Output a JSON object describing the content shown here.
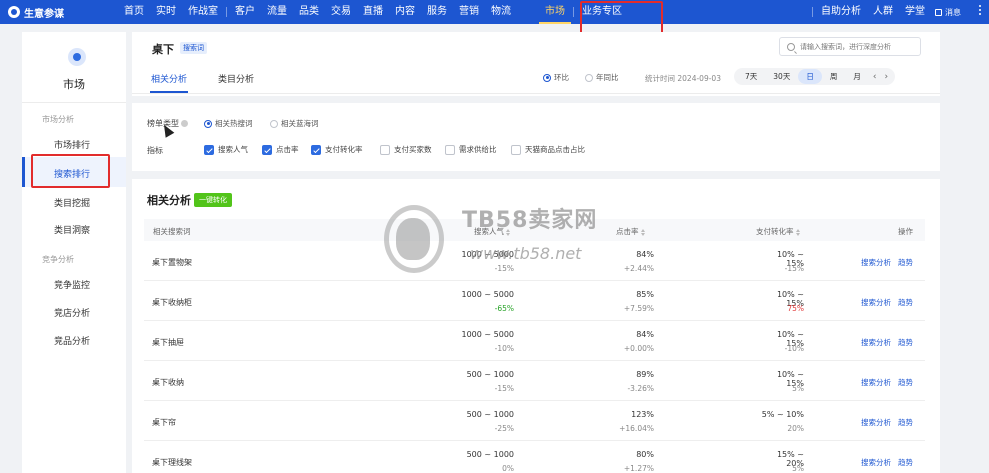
{
  "app": {
    "logo_text": "生意参谋"
  },
  "topnav": {
    "items": [
      "首页",
      "实时",
      "作战室",
      "客户",
      "流量",
      "品类",
      "交易",
      "直播",
      "内容",
      "服务",
      "营销",
      "物流",
      "市场",
      "业务专区"
    ],
    "right_items": [
      "自助分析",
      "人群",
      "学堂"
    ],
    "active": "市场",
    "message": "消息"
  },
  "sidebar": {
    "title": "市场",
    "group1": "市场分析",
    "items1": [
      "市场排行",
      "搜索排行",
      "类目挖掘",
      "类目洞察"
    ],
    "group2": "竞争分析",
    "items2": [
      "竞争监控",
      "竞店分析",
      "竞品分析"
    ],
    "active": "搜索排行"
  },
  "header": {
    "keyword": "桌下",
    "tag": "搜索词",
    "search_placeholder": "请输入搜索词，进行深度分析"
  },
  "tabs": [
    "相关分析",
    "类目分析"
  ],
  "compare": {
    "options": [
      "环比",
      "年同比"
    ],
    "selected": "环比"
  },
  "stat_time": "统计时间 2024-09-03",
  "periods": [
    "7天",
    "30天",
    "日",
    "周",
    "月"
  ],
  "active_period": "日",
  "filters": {
    "rank_type_label": "榜单类型",
    "rank_types": [
      "相关热搜词",
      "相关蓝海词"
    ],
    "rank_selected": "相关热搜词",
    "metrics_label": "指标",
    "metrics": [
      {
        "label": "搜索人气",
        "checked": true
      },
      {
        "label": "点击率",
        "checked": true
      },
      {
        "label": "支付转化率",
        "checked": true
      },
      {
        "label": "支付买家数",
        "checked": false
      },
      {
        "label": "需求供给比",
        "checked": false
      },
      {
        "label": "天猫商品点击占比",
        "checked": false
      }
    ]
  },
  "table": {
    "title": "相关分析",
    "convert_button": "一键转化",
    "headers": [
      "相关搜索词",
      "搜索人气",
      "点击率",
      "支付转化率",
      "操作"
    ],
    "action_labels": [
      "搜索分析",
      "趋势"
    ],
    "rows": [
      {
        "keyword": "桌下置物架",
        "popularity": "1000 ~ 5000",
        "pop_change": "-15%",
        "ctr": "84%",
        "ctr_change": "+2.44%",
        "cvr": "10% ~ 15%",
        "cvr_change": "-15%"
      },
      {
        "keyword": "桌下收纳柜",
        "popularity": "1000 ~ 5000",
        "pop_change": "-65%",
        "ctr": "85%",
        "ctr_change": "+7.59%",
        "cvr": "10% ~ 15%",
        "cvr_change": "75%"
      },
      {
        "keyword": "桌下抽屉",
        "popularity": "1000 ~ 5000",
        "pop_change": "-10%",
        "ctr": "84%",
        "ctr_change": "+0.00%",
        "cvr": "10% ~ 15%",
        "cvr_change": "-10%"
      },
      {
        "keyword": "桌下收纳",
        "popularity": "500 ~ 1000",
        "pop_change": "-15%",
        "ctr": "89%",
        "ctr_change": "-3.26%",
        "cvr": "10% ~ 15%",
        "cvr_change": "5%"
      },
      {
        "keyword": "桌下帘",
        "popularity": "500 ~ 1000",
        "pop_change": "-25%",
        "ctr": "123%",
        "ctr_change": "+16.04%",
        "cvr": "5% ~ 10%",
        "cvr_change": "20%"
      },
      {
        "keyword": "桌下理线架",
        "popularity": "500 ~ 1000",
        "pop_change": "0%",
        "ctr": "80%",
        "ctr_change": "+1.27%",
        "cvr": "15% ~ 20%",
        "cvr_change": "5%"
      }
    ]
  },
  "watermark": {
    "brand": "TB58卖家网",
    "url": "www.tb58.net"
  },
  "colors": {
    "primary": "#1d56d1",
    "highlight": "#e22c2c",
    "positive": "#29a329",
    "accent_green": "#52c41a"
  }
}
